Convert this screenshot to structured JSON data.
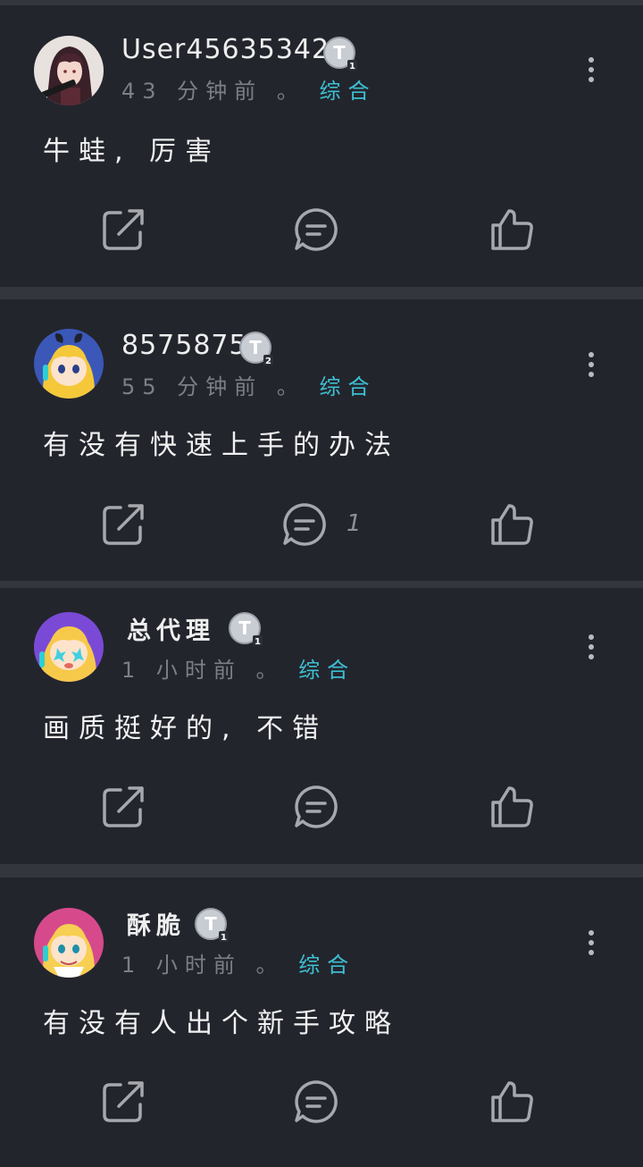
{
  "colors": {
    "background": "#33363d",
    "card": "#23252d",
    "username": "#eeeeee",
    "meta": "#7c7f86",
    "category": "#3dbfd1",
    "content": "#f1f1f1",
    "icon": "#a6a8ad"
  },
  "posts": [
    {
      "username": "User456353425",
      "level_badge": "T1",
      "time": "43 分钟前",
      "separator": "。",
      "category": "综合",
      "content": "牛蛙, 厉害",
      "comment_count": ""
    },
    {
      "username": "8575875",
      "level_badge": "T2",
      "time": "55 分钟前",
      "separator": "。",
      "category": "综合",
      "content": "有没有快速上手的办法",
      "comment_count": "1"
    },
    {
      "username": "总代理",
      "level_badge": "T1",
      "time": "1 小时前",
      "separator": "。",
      "category": "综合",
      "content": "画质挺好的, 不错",
      "comment_count": ""
    },
    {
      "username": "酥脆",
      "level_badge": "T1",
      "time": "1 小时前",
      "separator": "。",
      "category": "综合",
      "content": "有没有人出个新手攻略",
      "comment_count": ""
    }
  ],
  "icons": {
    "more": "more-vertical-icon",
    "share": "share-icon",
    "comment": "comment-icon",
    "like": "thumbs-up-icon"
  }
}
